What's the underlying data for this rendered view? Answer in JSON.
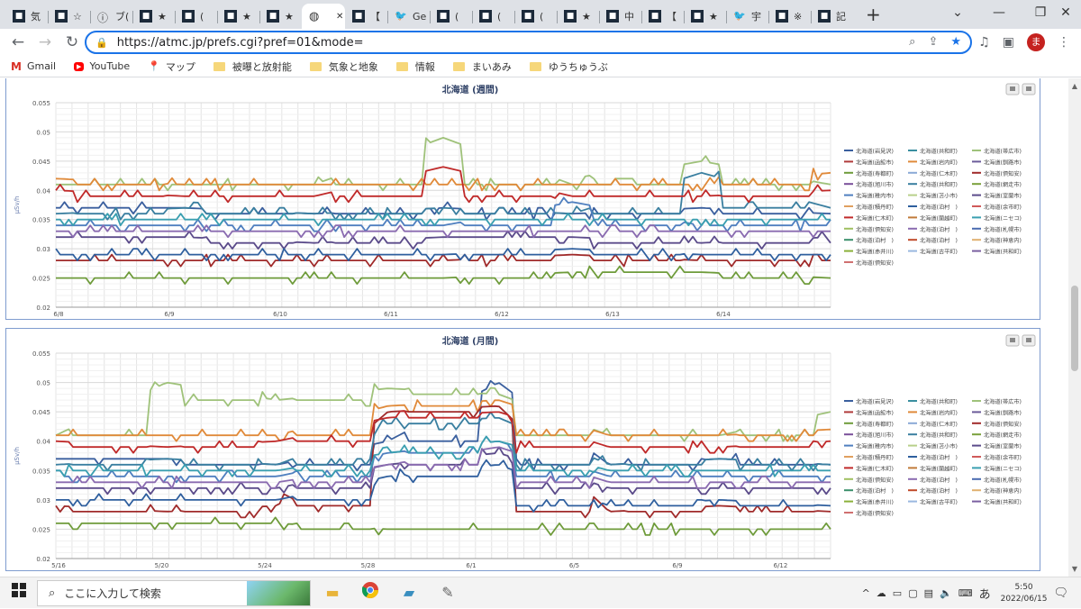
{
  "browser": {
    "tabs": [
      {
        "label": "気",
        "icon": "site-dark-icon"
      },
      {
        "label": "☆",
        "icon": "site-dark-icon"
      },
      {
        "label": "ブ(",
        "icon": "info-icon"
      },
      {
        "label": "★",
        "icon": "site-dark-icon"
      },
      {
        "label": "(",
        "icon": "site-dark-icon"
      },
      {
        "label": "★",
        "icon": "site-dark-icon"
      },
      {
        "label": "★",
        "icon": "site-dark-icon"
      },
      {
        "label": "",
        "icon": "globe-icon",
        "active": true
      },
      {
        "label": "【",
        "icon": "site-dark-icon"
      },
      {
        "label": "Ge",
        "icon": "twitter-icon"
      },
      {
        "label": "(",
        "icon": "site-dark-icon"
      },
      {
        "label": "(",
        "icon": "site-dark-icon"
      },
      {
        "label": "(",
        "icon": "site-dark-icon"
      },
      {
        "label": "★",
        "icon": "site-dark-icon"
      },
      {
        "label": "中",
        "icon": "site-dark-icon"
      },
      {
        "label": "【",
        "icon": "site-dark-icon"
      },
      {
        "label": "★",
        "icon": "site-dark-icon"
      },
      {
        "label": "宇",
        "icon": "twitter-icon"
      },
      {
        "label": "※",
        "icon": "site-dark-icon"
      },
      {
        "label": "記",
        "icon": "site-dark-icon"
      }
    ],
    "url": "https://atmc.jp/prefs.cgi?pref=01&mode=",
    "avatar_letter": "ま",
    "bookmarks": [
      {
        "label": "Gmail",
        "icon": "gmail-icon"
      },
      {
        "label": "YouTube",
        "icon": "youtube-icon"
      },
      {
        "label": "マップ",
        "icon": "maps-icon"
      },
      {
        "label": "被曝と放射能",
        "icon": "folder-icon"
      },
      {
        "label": "気象と地象",
        "icon": "folder-icon"
      },
      {
        "label": "情報",
        "icon": "folder-icon"
      },
      {
        "label": "まいあみ",
        "icon": "folder-icon"
      },
      {
        "label": "ゆうちゅうぶ",
        "icon": "folder-icon"
      }
    ]
  },
  "legend": [
    {
      "label": "北海道(岩見沢)",
      "color": "#3a5f9e"
    },
    {
      "label": "北海道(共和町)",
      "color": "#3a8fa0"
    },
    {
      "label": "北海道(帯広市)",
      "color": "#9fc27a"
    },
    {
      "label": "北海道(函館市)",
      "color": "#b03a3a"
    },
    {
      "label": "北海道(岩内町)",
      "color": "#e08a3a"
    },
    {
      "label": "北海道(釧路市)",
      "color": "#6b5b9a"
    },
    {
      "label": "北海道(寿都町)",
      "color": "#6e9b3a"
    },
    {
      "label": "北海道(仁木町)",
      "color": "#8aa9d6"
    },
    {
      "label": "北海道(倶知安)",
      "color": "#a02a2a"
    },
    {
      "label": "北海道(旭川市)",
      "color": "#7a4f9a"
    },
    {
      "label": "北海道(共和町)",
      "color": "#3a7fa0"
    },
    {
      "label": "北海道(網走市)",
      "color": "#7aa03a"
    },
    {
      "label": "北海道(稚内市)",
      "color": "#4f7fbf"
    },
    {
      "label": "北海道(苫小市)",
      "color": "#b8d08a"
    },
    {
      "label": "北海道(室蘭市)",
      "color": "#5b4b8a"
    },
    {
      "label": "北海道(積丹町)",
      "color": "#e0a060"
    },
    {
      "label": "北海道(泊村　)",
      "color": "#2f5f9e"
    },
    {
      "label": "北海道(余市町)",
      "color": "#d05a5a"
    },
    {
      "label": "北海道(仁木町)",
      "color": "#c02a2a"
    },
    {
      "label": "北海道(蘭越町)",
      "color": "#c07a3a"
    },
    {
      "label": "北海道(ニセコ)",
      "color": "#3a9fb0"
    },
    {
      "label": "北海道(倶知安)",
      "color": "#a0c060"
    },
    {
      "label": "北海道(泊村　)",
      "color": "#8a6bb0"
    },
    {
      "label": "北海道(札幌市)",
      "color": "#4a6bb0"
    },
    {
      "label": "北海道(泊村　)",
      "color": "#3a8f6a"
    },
    {
      "label": "北海道(泊村　)",
      "color": "#c04a2a"
    },
    {
      "label": "北海道(神恵内)",
      "color": "#e0b070"
    },
    {
      "label": "北海道(赤井川)",
      "color": "#8ab03a"
    },
    {
      "label": "北海道(古平町)",
      "color": "#9ab8e0"
    },
    {
      "label": "北海道(共和町)",
      "color": "#7a5fa0"
    },
    {
      "label": "北海道(倶知安)",
      "color": "#d07070"
    }
  ],
  "charts": [
    {
      "title": "北海道 (週間)",
      "ylabel": "μSv/h",
      "y_ticks": [
        "0.055",
        "0.05",
        "0.045",
        "0.04",
        "0.035",
        "0.03",
        "0.025",
        "0.02"
      ],
      "x_ticks": [
        "6/8",
        "6/9",
        "6/10",
        "6/11",
        "6/12",
        "6/13",
        "6/14"
      ]
    },
    {
      "title": "北海道 (月間)",
      "ylabel": "μSv/h",
      "y_ticks": [
        "0.055",
        "0.05",
        "0.045",
        "0.04",
        "0.035",
        "0.03",
        "0.025",
        "0.02"
      ],
      "x_ticks": [
        "5/16",
        "5/20",
        "5/24",
        "5/28",
        "6/1",
        "6/5",
        "6/9",
        "6/12"
      ]
    }
  ],
  "chart_data": [
    {
      "type": "line",
      "title": "北海道 (週間)",
      "ylabel": "μSv/h",
      "ylim": [
        0.02,
        0.055
      ],
      "x": [
        "6/8",
        "6/9",
        "6/10",
        "6/11",
        "6/12",
        "6/13",
        "6/14"
      ],
      "series": [
        {
          "name": "北海道(岩見沢)",
          "values": [
            0.037,
            0.037,
            0.036,
            0.037,
            0.036,
            0.037,
            0.036
          ]
        },
        {
          "name": "北海道(旭川市)",
          "values": [
            0.041,
            0.041,
            0.041,
            0.049,
            0.041,
            0.045,
            0.041
          ]
        },
        {
          "name": "北海道(函館市)",
          "values": [
            0.042,
            0.041,
            0.041,
            0.041,
            0.041,
            0.041,
            0.043
          ]
        },
        {
          "name": "北海道(共和町)",
          "values": [
            0.025,
            0.025,
            0.025,
            0.025,
            0.026,
            0.026,
            0.025
          ]
        },
        {
          "name": "北海道(寿都町)",
          "values": [
            0.028,
            0.028,
            0.028,
            0.028,
            0.029,
            0.028,
            0.028
          ]
        },
        {
          "name": "北海道(帯広市)",
          "values": [
            0.036,
            0.037,
            0.036,
            0.037,
            0.036,
            0.043,
            0.037
          ]
        },
        {
          "name": "北海道(稚内市)",
          "values": [
            0.034,
            0.034,
            0.034,
            0.034,
            0.038,
            0.034,
            0.034
          ]
        },
        {
          "name": "北海道(積丹町)",
          "values": [
            0.032,
            0.032,
            0.031,
            0.032,
            0.032,
            0.031,
            0.032
          ]
        },
        {
          "name": "北海道(余市町)",
          "values": [
            0.029,
            0.029,
            0.029,
            0.029,
            0.03,
            0.029,
            0.029
          ]
        },
        {
          "name": "北海道(ニセコ)",
          "values": [
            0.04,
            0.039,
            0.039,
            0.044,
            0.039,
            0.039,
            0.04
          ]
        },
        {
          "name": "北海道(赤井川)",
          "values": [
            0.035,
            0.035,
            0.035,
            0.035,
            0.035,
            0.035,
            0.035
          ]
        },
        {
          "name": "北海道(仁木町)",
          "values": [
            0.033,
            0.033,
            0.033,
            0.033,
            0.033,
            0.033,
            0.033
          ]
        }
      ]
    },
    {
      "type": "line",
      "title": "北海道 (月間)",
      "ylabel": "μSv/h",
      "ylim": [
        0.02,
        0.055
      ],
      "x": [
        "5/16",
        "5/20",
        "5/24",
        "5/28",
        "6/1",
        "6/5",
        "6/9",
        "6/12"
      ],
      "series": [
        {
          "name": "北海道(岩見沢)",
          "values": [
            0.037,
            0.037,
            0.036,
            0.04,
            0.05,
            0.036,
            0.037,
            0.036
          ]
        },
        {
          "name": "北海道(旭川市)",
          "values": [
            0.041,
            0.05,
            0.047,
            0.049,
            0.048,
            0.041,
            0.041,
            0.045
          ]
        },
        {
          "name": "北海道(函館市)",
          "values": [
            0.041,
            0.041,
            0.041,
            0.046,
            0.047,
            0.041,
            0.041,
            0.042
          ]
        },
        {
          "name": "北海道(共和町)",
          "values": [
            0.026,
            0.026,
            0.026,
            0.025,
            0.025,
            0.025,
            0.025,
            0.025
          ]
        },
        {
          "name": "北海道(寿都町)",
          "values": [
            0.029,
            0.028,
            0.029,
            0.045,
            0.046,
            0.028,
            0.029,
            0.028
          ]
        },
        {
          "name": "北海道(帯広市)",
          "values": [
            0.036,
            0.037,
            0.036,
            0.043,
            0.044,
            0.036,
            0.037,
            0.036
          ]
        },
        {
          "name": "北海道(稚内市)",
          "values": [
            0.034,
            0.034,
            0.034,
            0.038,
            0.04,
            0.034,
            0.034,
            0.034
          ]
        },
        {
          "name": "北海道(積丹町)",
          "values": [
            0.032,
            0.032,
            0.032,
            0.036,
            0.038,
            0.032,
            0.032,
            0.032
          ]
        },
        {
          "name": "北海道(余市町)",
          "values": [
            0.03,
            0.03,
            0.03,
            0.034,
            0.036,
            0.029,
            0.03,
            0.029
          ]
        },
        {
          "name": "北海道(ニセコ)",
          "values": [
            0.04,
            0.039,
            0.04,
            0.044,
            0.045,
            0.039,
            0.039,
            0.04
          ]
        },
        {
          "name": "北海道(赤井川)",
          "values": [
            0.035,
            0.035,
            0.035,
            0.038,
            0.04,
            0.035,
            0.035,
            0.035
          ]
        },
        {
          "name": "北海道(仁木町)",
          "values": [
            0.033,
            0.033,
            0.033,
            0.036,
            0.039,
            0.033,
            0.033,
            0.033
          ]
        }
      ]
    }
  ],
  "taskbar": {
    "search_placeholder": "ここに入力して検索",
    "ime": "あ",
    "time": "5:50",
    "date": "2022/06/15"
  }
}
